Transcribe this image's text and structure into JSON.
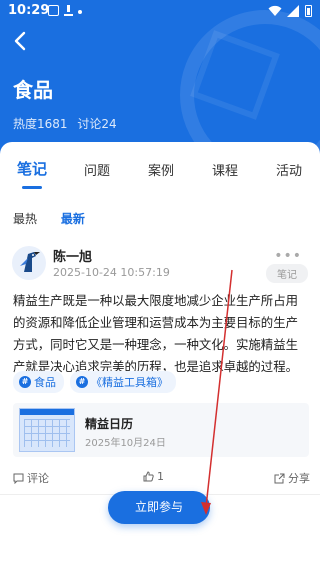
{
  "status": {
    "time": "10:29"
  },
  "header": {
    "title": "食品",
    "heat": "热度1681",
    "discuss": "讨论24"
  },
  "tabs": [
    {
      "label": "笔记",
      "active": true
    },
    {
      "label": "问题"
    },
    {
      "label": "案例"
    },
    {
      "label": "课程"
    },
    {
      "label": "活动"
    }
  ],
  "sort": {
    "hot": "最热",
    "new": "最新"
  },
  "post": {
    "author": "陈一旭",
    "time": "2025-10-24 10:57:19",
    "type": "笔记",
    "body": "精益生产既是一种以最大限度地减少企业生产所占用的资源和降低企业管理和运营成本为主要目标的生产方式，同时它又是一种理念，一种文化。实施精益生产就是决心追求完美的历程，也是追求卓越的过程。",
    "tags": [
      "食品",
      "《精益工具箱》"
    ],
    "card": {
      "title": "精益日历",
      "date": "2025年10月24日"
    },
    "comment_label": "评论",
    "like_count": "1",
    "share_label": "分享"
  },
  "cta": {
    "label": "立即参与"
  },
  "colors": {
    "primary": "#1a6fe0",
    "annotation": "#d32f2f"
  }
}
